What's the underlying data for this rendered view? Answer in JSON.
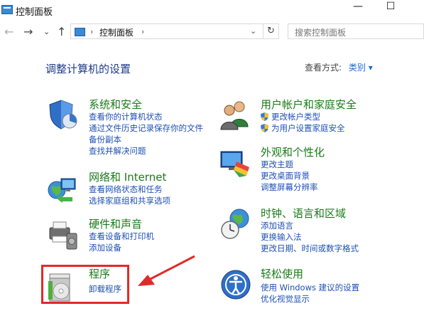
{
  "window": {
    "title": "控制面板",
    "minimize": "—",
    "maximize": "☐"
  },
  "nav": {
    "back": "←",
    "forward": "→",
    "recent": "⌄",
    "up": "↑",
    "address": "控制面板",
    "address_sep": "›",
    "dropdown": "⌄",
    "refresh": "↻",
    "search_placeholder": "搜索控制面板"
  },
  "main": {
    "heading": "调整计算机的设置",
    "view_by_label": "查看方式:",
    "view_by_value": "类别",
    "view_by_caret": "▾",
    "left": [
      {
        "title": "系统和安全",
        "links": [
          "查看你的计算机状态",
          "通过文件历史记录保存你的文件",
          "备份副本",
          "查找并解决问题"
        ]
      },
      {
        "title": "网络和 Internet",
        "links": [
          "查看网络状态和任务",
          "选择家庭组和共享选项"
        ]
      },
      {
        "title": "硬件和声音",
        "links": [
          "查看设备和打印机",
          "添加设备"
        ]
      },
      {
        "title": "程序",
        "links": [
          "卸载程序"
        ]
      }
    ],
    "right": [
      {
        "title": "用户帐户和家庭安全",
        "links": [
          "更改帐户类型",
          "为用户设置家庭安全"
        ]
      },
      {
        "title": "外观和个性化",
        "links": [
          "更改主题",
          "更改桌面背景",
          "调整屏幕分辨率"
        ]
      },
      {
        "title": "时钟、语言和区域",
        "links": [
          "添加语言",
          "更换输入法",
          "更改日期、时间或数字格式"
        ]
      },
      {
        "title": "轻松使用",
        "links": [
          "使用 Windows 建议的设置",
          "优化视觉显示"
        ]
      }
    ]
  }
}
